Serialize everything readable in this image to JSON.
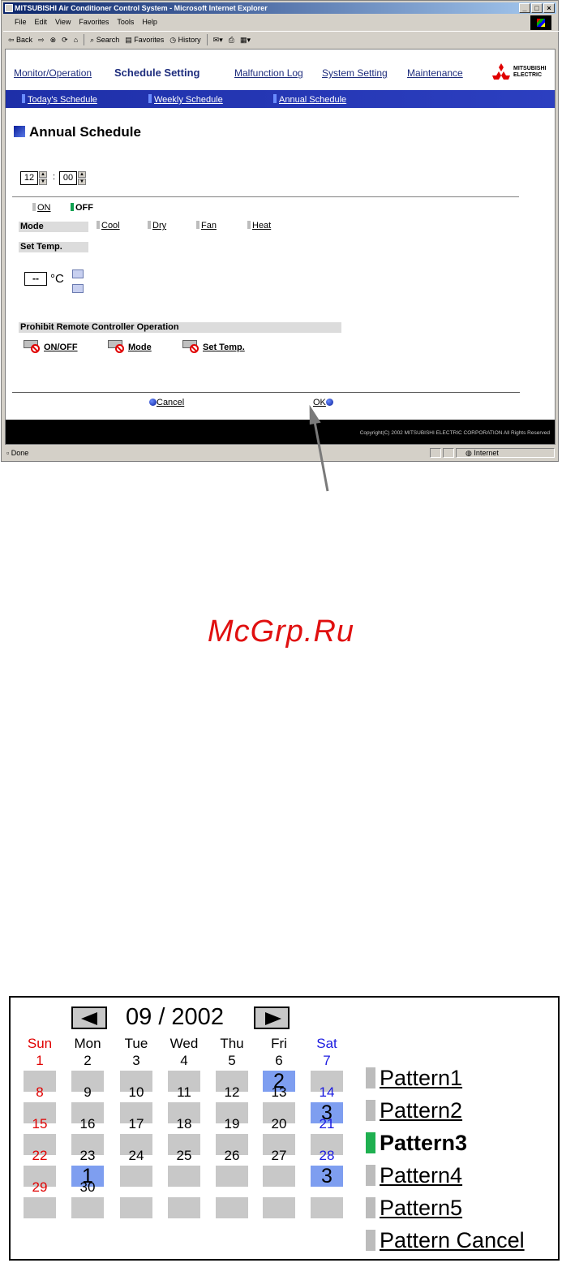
{
  "browser": {
    "title": "MITSUBISHI Air Conditioner Control System - Microsoft Internet Explorer",
    "menu": [
      "File",
      "Edit",
      "View",
      "Favorites",
      "Tools",
      "Help"
    ],
    "toolbar": {
      "back": "⇦ Back",
      "forward": "⇨",
      "search": "Search",
      "favorites": "Favorites",
      "history": "History"
    },
    "status": {
      "text": "Done",
      "zone": "Internet"
    }
  },
  "nav": {
    "items": [
      "Monitor/Operation",
      "Schedule Setting",
      "Malfunction Log",
      "System Setting",
      "Maintenance"
    ],
    "active": "Schedule Setting",
    "sub_items": [
      "Today's Schedule",
      "Weekly Schedule",
      "Annual Schedule"
    ],
    "logo_text": [
      "MITSUBISHI",
      "ELECTRIC"
    ]
  },
  "page": {
    "title": "Annual Schedule",
    "hour": "12",
    "minute": "00",
    "colon": ":",
    "on_label": "ON",
    "off_label": "OFF",
    "mode_label": "Mode",
    "modes": [
      "Cool",
      "Dry",
      "Fan",
      "Heat"
    ],
    "set_temp_label": "Set Temp.",
    "temp_value": "--",
    "temp_unit": "°C",
    "prohibit_label": "Prohibit Remote Controller Operation",
    "prohibit_items": [
      "ON/OFF",
      "Mode",
      "Set Temp."
    ],
    "cancel": "Cancel",
    "ok": "OK",
    "copyright": "Copyright(C) 2002 MITSUBISHI ELECTRIC CORPORATION All Rights Reserved"
  },
  "watermark": "McGrp.Ru",
  "calendar": {
    "month_title": "09 / 2002",
    "days_of_week": [
      "Sun",
      "Mon",
      "Tue",
      "Wed",
      "Thu",
      "Fri",
      "Sat"
    ],
    "weeks": [
      [
        {
          "d": "1",
          "p": ""
        },
        {
          "d": "2",
          "p": ""
        },
        {
          "d": "3",
          "p": ""
        },
        {
          "d": "4",
          "p": ""
        },
        {
          "d": "5",
          "p": ""
        },
        {
          "d": "6",
          "p": "2"
        },
        {
          "d": "7",
          "p": ""
        }
      ],
      [
        {
          "d": "8",
          "p": ""
        },
        {
          "d": "9",
          "p": ""
        },
        {
          "d": "10",
          "p": ""
        },
        {
          "d": "11",
          "p": ""
        },
        {
          "d": "12",
          "p": ""
        },
        {
          "d": "13",
          "p": ""
        },
        {
          "d": "14",
          "p": "3"
        }
      ],
      [
        {
          "d": "15",
          "p": ""
        },
        {
          "d": "16",
          "p": ""
        },
        {
          "d": "17",
          "p": ""
        },
        {
          "d": "18",
          "p": ""
        },
        {
          "d": "19",
          "p": ""
        },
        {
          "d": "20",
          "p": ""
        },
        {
          "d": "21",
          "p": ""
        }
      ],
      [
        {
          "d": "22",
          "p": ""
        },
        {
          "d": "23",
          "p": "1"
        },
        {
          "d": "24",
          "p": ""
        },
        {
          "d": "25",
          "p": ""
        },
        {
          "d": "26",
          "p": ""
        },
        {
          "d": "27",
          "p": ""
        },
        {
          "d": "28",
          "p": "3"
        }
      ],
      [
        {
          "d": "29",
          "p": ""
        },
        {
          "d": "30",
          "p": ""
        },
        {
          "d": "",
          "p": ""
        },
        {
          "d": "",
          "p": ""
        },
        {
          "d": "",
          "p": ""
        },
        {
          "d": "",
          "p": ""
        },
        {
          "d": "",
          "p": ""
        }
      ]
    ],
    "patterns": [
      "Pattern1",
      "Pattern2",
      "Pattern3",
      "Pattern4",
      "Pattern5",
      "Pattern Cancel"
    ],
    "selected_pattern": "Pattern3",
    "colors": {
      "sunday": "#e00000",
      "saturday": "#1a1ae0",
      "assigned": "#7e9ef0",
      "unassigned": "#c8c8c8",
      "selected_marker": "#1fb050"
    }
  }
}
